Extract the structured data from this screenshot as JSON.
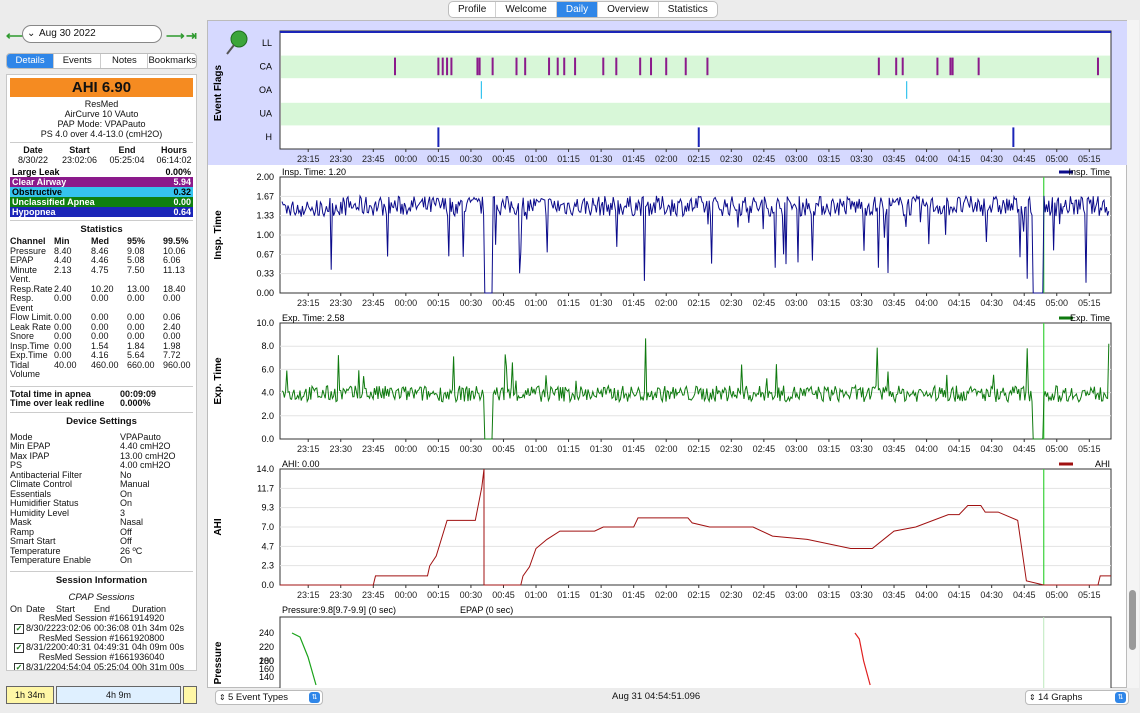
{
  "top_tabs": [
    {
      "label": "Profile",
      "active": false
    },
    {
      "label": "Welcome",
      "active": false
    },
    {
      "label": "Daily",
      "active": true
    },
    {
      "label": "Overview",
      "active": false
    },
    {
      "label": "Statistics",
      "active": false
    }
  ],
  "date_nav": {
    "date": "Aug 30 2022"
  },
  "sub_tabs": [
    {
      "label": "Details",
      "active": true
    },
    {
      "label": "Events",
      "active": false
    },
    {
      "label": "Notes",
      "active": false
    },
    {
      "label": "Bookmarks",
      "active": false
    }
  ],
  "summary": {
    "ahi": "AHI 6.90",
    "brand": "ResMed",
    "model": "AirCurve 10 VAuto",
    "pap_mode": "PAP Mode: VPAPauto",
    "ps": "PS 4.0 over 4.4-13.0 (cmH2O)"
  },
  "session_summary": {
    "headers": [
      "Date",
      "Start",
      "End",
      "Hours"
    ],
    "values": [
      "8/30/22",
      "23:02:06",
      "05:25:04",
      "06:14:02"
    ]
  },
  "events": [
    {
      "label": "Large Leak",
      "value": "0.00%",
      "bg": "#ffffff",
      "fg": "#000000"
    },
    {
      "label": "Clear Airway",
      "value": "5.94",
      "bg": "#8b1a8b",
      "fg": "#ffffff"
    },
    {
      "label": "Obstructive",
      "value": "0.32",
      "bg": "#35c3ee",
      "fg": "#000000"
    },
    {
      "label": "Unclassified Apnea",
      "value": "0.00",
      "bg": "#0f7f0f",
      "fg": "#ffffff"
    },
    {
      "label": "Hypopnea",
      "value": "0.64",
      "bg": "#1b25b8",
      "fg": "#ffffff"
    }
  ],
  "statistics": {
    "title": "Statistics",
    "headers": [
      "Channel",
      "Min",
      "Med",
      "95%",
      "99.5%"
    ],
    "rows": [
      [
        "Pressure",
        "8.40",
        "8.46",
        "9.08",
        "10.06"
      ],
      [
        "EPAP",
        "4.40",
        "4.46",
        "5.08",
        "6.06"
      ],
      [
        "Minute",
        "2.13",
        "4.75",
        "7.50",
        "11.13"
      ],
      [
        "Vent.",
        "",
        "",
        "",
        ""
      ],
      [
        "Resp.Rate",
        "2.40",
        "10.20",
        "13.00",
        "18.40"
      ],
      [
        "Resp.",
        "0.00",
        "0.00",
        "0.00",
        "0.00"
      ],
      [
        "Event",
        "",
        "",
        "",
        ""
      ],
      [
        "Flow Limit.",
        "0.00",
        "0.00",
        "0.00",
        "0.06"
      ],
      [
        "Leak Rate",
        "0.00",
        "0.00",
        "0.00",
        "2.40"
      ],
      [
        "Snore",
        "0.00",
        "0.00",
        "0.00",
        "0.00"
      ],
      [
        "Insp.Time",
        "0.00",
        "1.54",
        "1.84",
        "1.98"
      ],
      [
        "Exp.Time",
        "0.00",
        "4.16",
        "5.64",
        "7.72"
      ],
      [
        "Tidal",
        "40.00",
        "460.00",
        "660.00",
        "960.00"
      ],
      [
        "Volume",
        "",
        "",
        "",
        ""
      ]
    ]
  },
  "totals": [
    {
      "label": "Total time in apnea",
      "value": "00:09:09"
    },
    {
      "label": "Time over leak redline",
      "value": "0.000%"
    }
  ],
  "device_settings": {
    "title": "Device Settings",
    "rows": [
      [
        "Mode",
        "VPAPauto"
      ],
      [
        "Min EPAP",
        "4.40 cmH2O"
      ],
      [
        "Max IPAP",
        "13.00 cmH2O"
      ],
      [
        "PS",
        "4.00 cmH2O"
      ],
      [
        "Antibacterial Filter",
        "No"
      ],
      [
        "Climate Control",
        "Manual"
      ],
      [
        "Essentials",
        "On"
      ],
      [
        "Humidifier Status",
        "On"
      ],
      [
        "Humidity Level",
        "3"
      ],
      [
        "Mask",
        "Nasal"
      ],
      [
        "Ramp",
        "Off"
      ],
      [
        "Smart Start",
        "Off"
      ],
      [
        "Temperature",
        "26 ºC"
      ],
      [
        "Temperature Enable",
        "On"
      ]
    ]
  },
  "session_info": {
    "title": "Session Information",
    "subtitle": "CPAP Sessions",
    "headers": [
      "On",
      "Date",
      "Start",
      "End",
      "Duration"
    ],
    "sessions": [
      {
        "name": "ResMed Session #1661914920",
        "date": "8/30/22",
        "start": "23:02:06",
        "end": "00:36:08",
        "duration": "01h 34m 02s"
      },
      {
        "name": "ResMed Session #1661920800",
        "date": "8/31/22",
        "start": "00:40:31",
        "end": "04:49:31",
        "duration": "04h 09m 00s"
      },
      {
        "name": "ResMed Session #1661936040",
        "date": "8/31/22",
        "start": "04:54:04",
        "end": "05:25:04",
        "duration": "00h 31m 00s"
      }
    ]
  },
  "timeline_bar": {
    "left": "1h 34m",
    "mid": "4h 9m"
  },
  "footer": {
    "event_types": "5 Event Types",
    "cursor_time": "Aug 31 04:54:51.096",
    "graphs": "14 Graphs"
  },
  "time_ticks": [
    "23:15",
    "23:30",
    "23:45",
    "00:00",
    "00:15",
    "00:30",
    "00:45",
    "01:00",
    "01:15",
    "01:30",
    "01:45",
    "02:00",
    "02:15",
    "02:30",
    "02:45",
    "03:00",
    "03:15",
    "03:30",
    "03:45",
    "04:00",
    "04:15",
    "04:30",
    "04:45",
    "05:00",
    "05:15"
  ],
  "chart_data": [
    {
      "type": "event-flags",
      "ylabel": "Event Flags",
      "rows": [
        "LL",
        "CA",
        "OA",
        "UA",
        "H"
      ],
      "colors": {
        "CA": "#8b1a8b",
        "OA": "#35c3ee",
        "H": "#1b25b8"
      },
      "events": {
        "CA": [
          "23:55",
          "00:15",
          "00:17",
          "00:19",
          "00:21",
          "00:33",
          "00:34",
          "00:40",
          "00:51",
          "00:55",
          "01:06",
          "01:10",
          "01:13",
          "01:18",
          "01:31",
          "01:37",
          "01:48",
          "01:53",
          "02:00",
          "02:09",
          "02:19",
          "03:38",
          "03:46",
          "03:49",
          "04:05",
          "04:11",
          "04:12",
          "04:24",
          "05:19"
        ],
        "OA": [
          "00:35",
          "03:51"
        ],
        "H": [
          "00:15",
          "02:15",
          "04:40"
        ]
      }
    },
    {
      "type": "line",
      "ylabel": "Insp. Time",
      "readout": "Insp. Time: 1.20",
      "series": [
        {
          "name": "Insp. Time",
          "color": "#0b0b8b"
        }
      ],
      "yticks": [
        "0.00",
        "0.33",
        "0.67",
        "1.00",
        "1.33",
        "1.67",
        "2.00"
      ],
      "ylim": [
        0,
        2.0
      ]
    },
    {
      "type": "line",
      "ylabel": "Exp. Time",
      "readout": "Exp. Time: 2.58",
      "series": [
        {
          "name": "Exp. Time",
          "color": "#0f7a0f"
        }
      ],
      "yticks": [
        "0.0",
        "2.0",
        "4.0",
        "6.0",
        "8.0",
        "10.0"
      ],
      "ylim": [
        0,
        10
      ]
    },
    {
      "type": "line",
      "ylabel": "AHI",
      "readout": "AHI: 0.00",
      "series": [
        {
          "name": "AHI",
          "color": "#a01010"
        }
      ],
      "yticks": [
        "0.0",
        "2.3",
        "4.7",
        "7.0",
        "9.3",
        "11.7",
        "14.0"
      ],
      "ylim": [
        0,
        14
      ],
      "points": [
        [
          "23:02",
          0
        ],
        [
          "23:45",
          0
        ],
        [
          "23:46",
          1.1
        ],
        [
          "00:10",
          1.1
        ],
        [
          "00:11",
          2.3
        ],
        [
          "00:14",
          3.5
        ],
        [
          "00:19",
          7.8
        ],
        [
          "00:32",
          7.8
        ],
        [
          "00:35",
          11.8
        ],
        [
          "00:36",
          14
        ],
        [
          "00:36",
          0
        ],
        [
          "00:40",
          0
        ],
        [
          "00:53",
          0
        ],
        [
          "00:54",
          1.1
        ],
        [
          "00:57",
          2.2
        ],
        [
          "01:00",
          4.4
        ],
        [
          "01:05",
          5.5
        ],
        [
          "01:11",
          6.5
        ],
        [
          "01:27",
          6.5
        ],
        [
          "01:31",
          7.0
        ],
        [
          "01:45",
          7.0
        ],
        [
          "01:47",
          8.1
        ],
        [
          "02:10",
          8.1
        ],
        [
          "02:12",
          7.5
        ],
        [
          "02:20",
          7.0
        ],
        [
          "02:40",
          7.0
        ],
        [
          "02:49",
          5.9
        ],
        [
          "03:05",
          5.5
        ],
        [
          "03:25",
          4.4
        ],
        [
          "03:35",
          4.4
        ],
        [
          "03:45",
          6.5
        ],
        [
          "03:55",
          7.0
        ],
        [
          "04:10",
          8.5
        ],
        [
          "04:15",
          8.5
        ],
        [
          "04:19",
          9.6
        ],
        [
          "04:25",
          9.6
        ],
        [
          "04:27",
          8.8
        ],
        [
          "04:33",
          8.8
        ],
        [
          "04:42",
          7.8
        ],
        [
          "04:46",
          0.5
        ],
        [
          "04:54",
          0
        ],
        [
          "05:19",
          0
        ],
        [
          "05:20",
          1.1
        ],
        [
          "05:25",
          1.1
        ]
      ]
    },
    {
      "type": "line",
      "ylabel": "Pressure",
      "readout": "Pressure:9.8[9.7-9.9] (0 sec)",
      "readout2": "EPAP (0 sec)",
      "yticks": [
        "200",
        "220",
        "240"
      ],
      "yticks_extra": [
        "140",
        "160",
        "180"
      ]
    }
  ]
}
